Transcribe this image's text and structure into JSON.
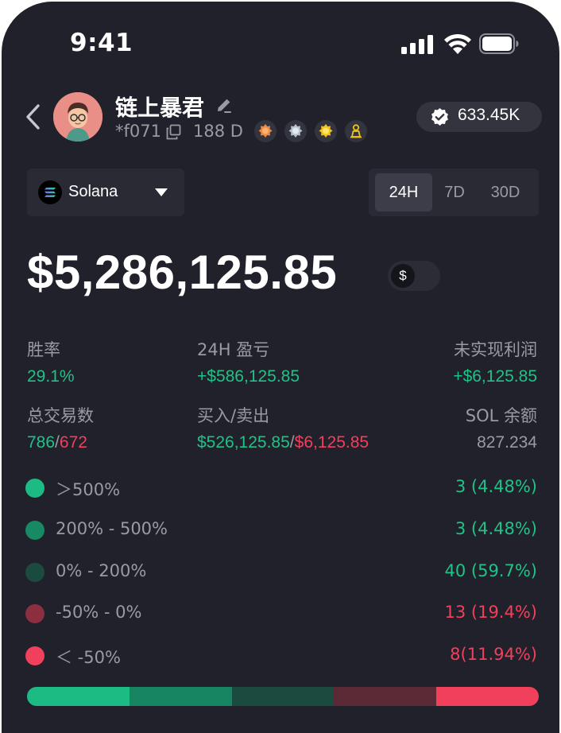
{
  "status_bar": {
    "time": "9:41"
  },
  "profile": {
    "name": "链上暴君",
    "wallet": "*f071",
    "days": "188 D",
    "followers": "633.45K"
  },
  "chain": {
    "selected": "Solana"
  },
  "period_tabs": [
    {
      "label": "24H",
      "active": true
    },
    {
      "label": "7D",
      "active": false
    },
    {
      "label": "30D",
      "active": false
    }
  ],
  "balance": {
    "value": "$5,286,125.85",
    "currency_symbol": "$"
  },
  "stats": {
    "win_rate": {
      "label": "胜率",
      "value": "29.1%"
    },
    "pnl_24h": {
      "label": "24H 盈亏",
      "value": "+$586,125.85"
    },
    "unrealized": {
      "label": "未实现利润",
      "value": "+$6,125.85"
    },
    "total_trades": {
      "label": "总交易数",
      "wins": "786",
      "sep": "/",
      "losses": "672"
    },
    "buy_sell": {
      "label": "买入/卖出",
      "buy": "$526,125.85",
      "sep": "/",
      "sell": "$6,125.85"
    },
    "sol_balance": {
      "label": "SOL 余额",
      "value": "827.234"
    }
  },
  "distribution": [
    {
      "label": "＞500%",
      "value": "3 (4.48%)",
      "color": "#1dbb84",
      "text_color": "#1fc287"
    },
    {
      "label": "200% - 500%",
      "value": "3 (4.48%)",
      "color": "#178a64",
      "text_color": "#1fc287"
    },
    {
      "label": "0% - 200%",
      "value": "40 (59.7%)",
      "color": "#1b4a3e",
      "text_color": "#1fc287"
    },
    {
      "label": "-50% - 0%",
      "value": "13 (19.4%)",
      "color": "#8a2e40",
      "text_color": "#f0405b"
    },
    {
      "label": "＜ -50%",
      "value": "8(11.94%)",
      "color": "#f0405b",
      "text_color": "#f0405b"
    }
  ],
  "distribution_bar": [
    {
      "name": "gt-500",
      "color": "#1dbb84"
    },
    {
      "name": "200-500",
      "color": "#188562"
    },
    {
      "name": "0-200",
      "color": "#1b4a3e"
    },
    {
      "name": "neg50-0",
      "color": "#5c2a36"
    },
    {
      "name": "lt-neg50",
      "color": "#f0405b"
    }
  ]
}
